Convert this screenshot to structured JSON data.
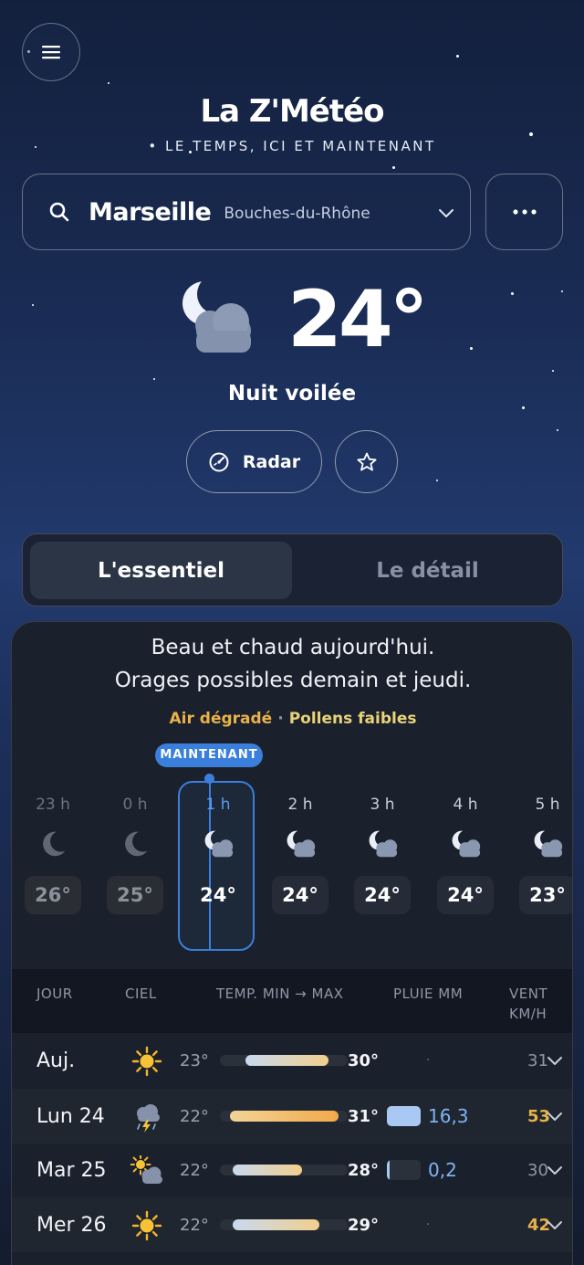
{
  "header": {
    "menu_icon": "hamburger-icon",
    "title": "La Z'Météo",
    "subtitle": "• LE TEMPS, ICI ET MAINTENANT"
  },
  "search": {
    "city": "Marseille",
    "region": "Bouches-du-Rhône",
    "search_icon": "search-icon",
    "dropdown_icon": "chevron-down-icon",
    "more_icon": "more-icon"
  },
  "current": {
    "icon": "moon-cloud-icon",
    "temp": "24°",
    "condition": "Nuit voilée",
    "radar_label": "Radar",
    "favorite_icon": "star-icon"
  },
  "tabs": [
    {
      "label": "L'essentiel",
      "active": true
    },
    {
      "label": "Le détail",
      "active": false
    }
  ],
  "summary": {
    "line1": "Beau et chaud aujourd'hui.",
    "line2": "Orages possibles demain et jeudi.",
    "air": "Air dégradé",
    "separator": "·",
    "pollen": "Pollens faibles"
  },
  "now_badge": "MAINTENANT",
  "hours": [
    {
      "label": "23 h",
      "temp": "26°",
      "icon": "moon-icon"
    },
    {
      "label": "0 h",
      "temp": "25°",
      "icon": "moon-icon"
    },
    {
      "label": "1 h",
      "temp": "24°",
      "icon": "moon-cloud-icon"
    },
    {
      "label": "2 h",
      "temp": "24°",
      "icon": "moon-cloud-icon"
    },
    {
      "label": "3 h",
      "temp": "24°",
      "icon": "moon-cloud-icon"
    },
    {
      "label": "4 h",
      "temp": "24°",
      "icon": "moon-cloud-icon"
    },
    {
      "label": "5 h",
      "temp": "23°",
      "icon": "moon-cloud-icon"
    }
  ],
  "table": {
    "headers": {
      "day": "JOUR",
      "sky": "CIEL",
      "temp": "TEMP. MIN → MAX",
      "rain": "PLUIE MM",
      "wind1": "VENT",
      "wind2": "KM/H"
    },
    "rows": [
      {
        "day": "Auj.",
        "icon": "sun-icon",
        "min": "23°",
        "max": "30°",
        "rain": "·",
        "rain_fraction": 0,
        "wind": "31",
        "bar_start": 0.2,
        "bar_end": 0.85
      },
      {
        "day": "Lun 24",
        "icon": "thunderstorm-icon",
        "min": "22°",
        "max": "31°",
        "rain": "16,3",
        "rain_fraction": 1,
        "wind": "53",
        "bar_start": 0.08,
        "bar_end": 0.93
      },
      {
        "day": "Mar 25",
        "icon": "sun-cloud-icon",
        "min": "22°",
        "max": "28°",
        "rain": "0,2",
        "rain_fraction": 0.06,
        "wind": "30",
        "bar_start": 0.1,
        "bar_end": 0.64
      },
      {
        "day": "Mer 26",
        "icon": "sun-icon",
        "min": "22°",
        "max": "29°",
        "rain": "·",
        "rain_fraction": 0,
        "wind": "42",
        "bar_start": 0.1,
        "bar_end": 0.78
      }
    ]
  }
}
